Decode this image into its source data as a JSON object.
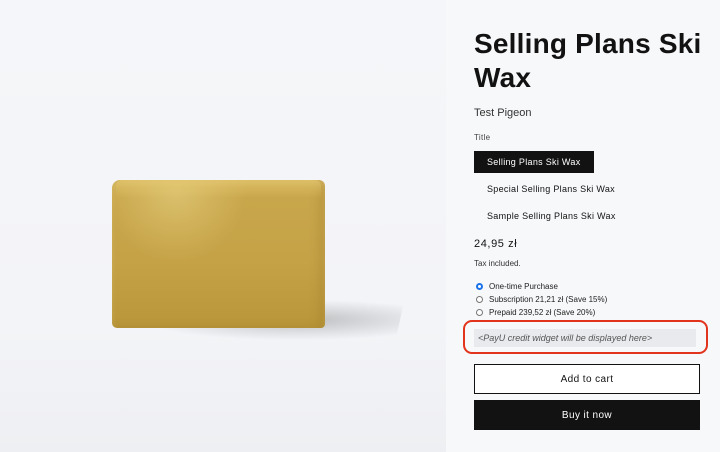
{
  "product": {
    "title": "Selling Plans Ski Wax",
    "vendor": "Test Pigeon",
    "option_label": "Title",
    "variants": [
      {
        "label": "Selling Plans Ski Wax",
        "selected": true
      },
      {
        "label": "Special Selling Plans Ski Wax",
        "selected": false
      },
      {
        "label": "Sample Selling Plans Ski Wax",
        "selected": false
      }
    ],
    "price": "24,95 zł",
    "tax_note": "Tax included."
  },
  "purchase_options": [
    {
      "label": "One-time Purchase",
      "selected": true
    },
    {
      "label": "Subscription 21,21 zł (Save 15%)",
      "selected": false
    },
    {
      "label": "Prepaid 239,52 zł (Save 20%)",
      "selected": false
    }
  ],
  "payu_widget": {
    "text": "<PayU credit widget will be displayed here>"
  },
  "buttons": {
    "add_to_cart": "Add to cart",
    "buy_now": "Buy it now"
  },
  "colors": {
    "accent": "#121212",
    "highlight": "#e2341d",
    "radio": "#1a73e8",
    "wax": "#c5a246"
  }
}
